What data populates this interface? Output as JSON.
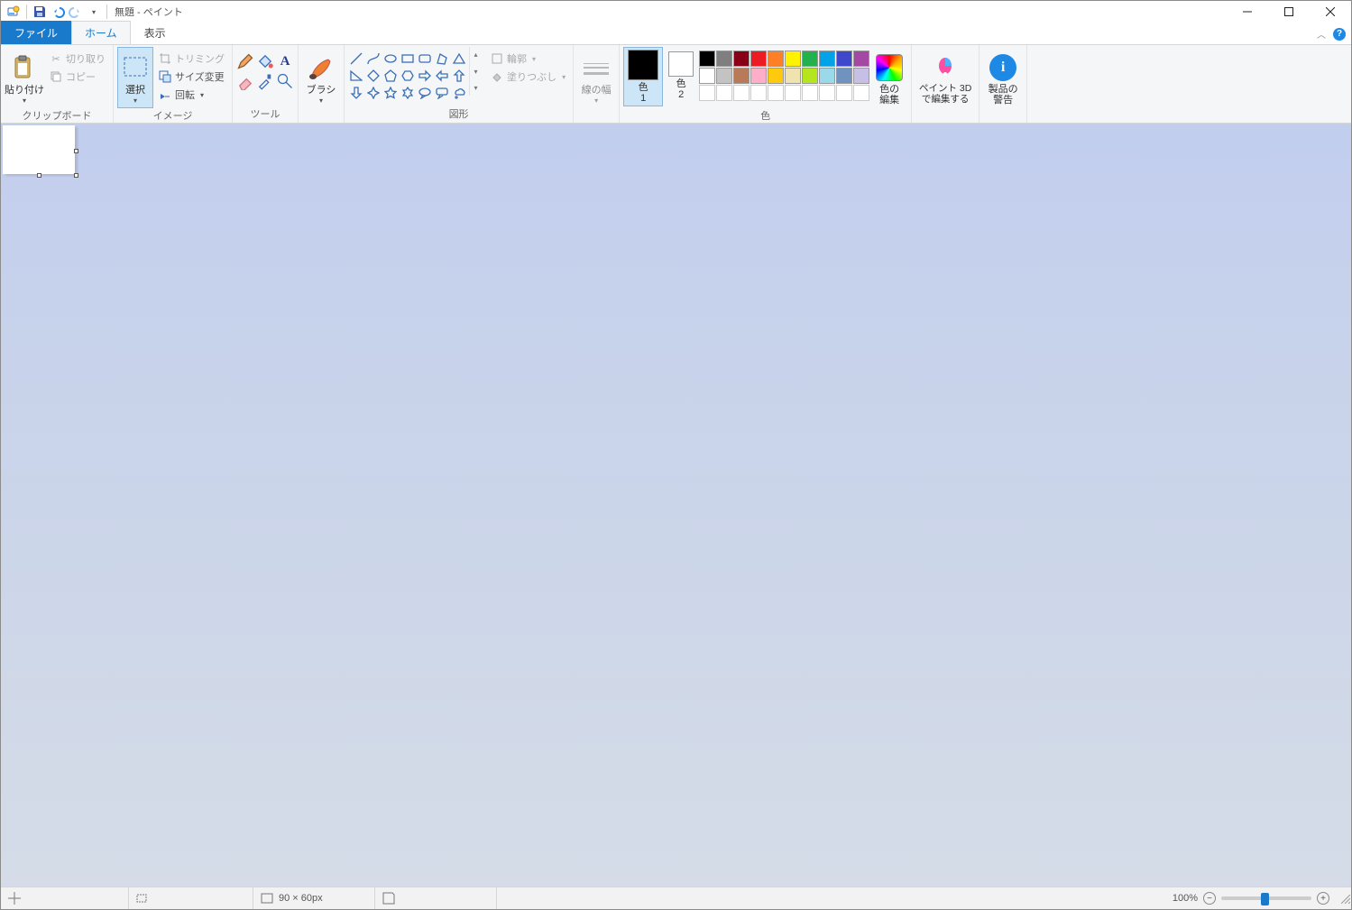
{
  "title": "無題 - ペイント",
  "tabs": {
    "file": "ファイル",
    "home": "ホーム",
    "view": "表示"
  },
  "groups": {
    "clipboard": {
      "label": "クリップボード",
      "paste": "貼り付け",
      "cut": "切り取り",
      "copy": "コピー"
    },
    "image": {
      "label": "イメージ",
      "select": "選択",
      "crop": "トリミング",
      "resize": "サイズ変更",
      "rotate": "回転"
    },
    "tools": {
      "label": "ツール"
    },
    "brushes": {
      "label": "ブラシ"
    },
    "shapes": {
      "label": "図形",
      "outline": "輪郭",
      "fill": "塗りつぶし"
    },
    "linewidth": {
      "label": "線の幅"
    },
    "colors": {
      "label": "色",
      "color1": "色\n1",
      "color2": "色\n2",
      "edit": "色の\n編集"
    },
    "paint3d": {
      "label": "ペイント 3D\nで編集する"
    },
    "alert": {
      "label": "製品の\n警告"
    }
  },
  "palette_row1": [
    "#000000",
    "#7f7f7f",
    "#880015",
    "#ed1c24",
    "#ff7f27",
    "#fff200",
    "#22b14c",
    "#00a2e8",
    "#3f48cc",
    "#a349a4"
  ],
  "palette_row2": [
    "#ffffff",
    "#c3c3c3",
    "#b97a57",
    "#ffaec9",
    "#ffc90e",
    "#efe4b0",
    "#b5e61d",
    "#99d9ea",
    "#7092be",
    "#c8bfe7"
  ],
  "color1_value": "#000000",
  "color2_value": "#ffffff",
  "canvas": {
    "size_text": "90 × 60px"
  },
  "zoom": {
    "level": "100%"
  }
}
